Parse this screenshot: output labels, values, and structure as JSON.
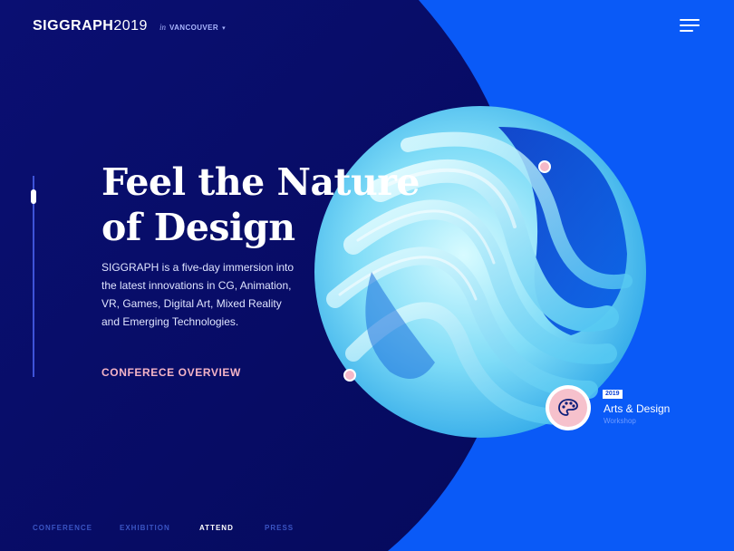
{
  "header": {
    "brand_name": "SIGGRAPH",
    "brand_year": "2019",
    "location_prefix": "in",
    "location": "VANCOUVER",
    "location_caret": "▾",
    "menu_icon": "hamburger-menu-icon"
  },
  "hero": {
    "title_line1": "Feel the Nature",
    "title_line2": "of Design",
    "description": "SIGGRAPH is a five-day immersion into the latest innovations in CG, Animation, VR, Games, Digital Art, Mixed Reality and Emerging Technologies.",
    "cta": "CONFERECE OVERVIEW"
  },
  "category": {
    "badge": "2019",
    "title": "Arts & Design",
    "subtitle": "Workshop",
    "icon": "palette-icon"
  },
  "nav": {
    "items": [
      {
        "label": "CONFERENCE",
        "active": false
      },
      {
        "label": "EXHIBITION",
        "active": false
      },
      {
        "label": "ATTEND",
        "active": true
      },
      {
        "label": "PRESS",
        "active": false
      }
    ]
  },
  "colors": {
    "dark_panel": "#080c6a",
    "bright_blue": "#0a5af7",
    "accent_pink": "#f4b4c6",
    "swirl_light": "#b8f0ff",
    "swirl_mid": "#3fc4f0"
  }
}
